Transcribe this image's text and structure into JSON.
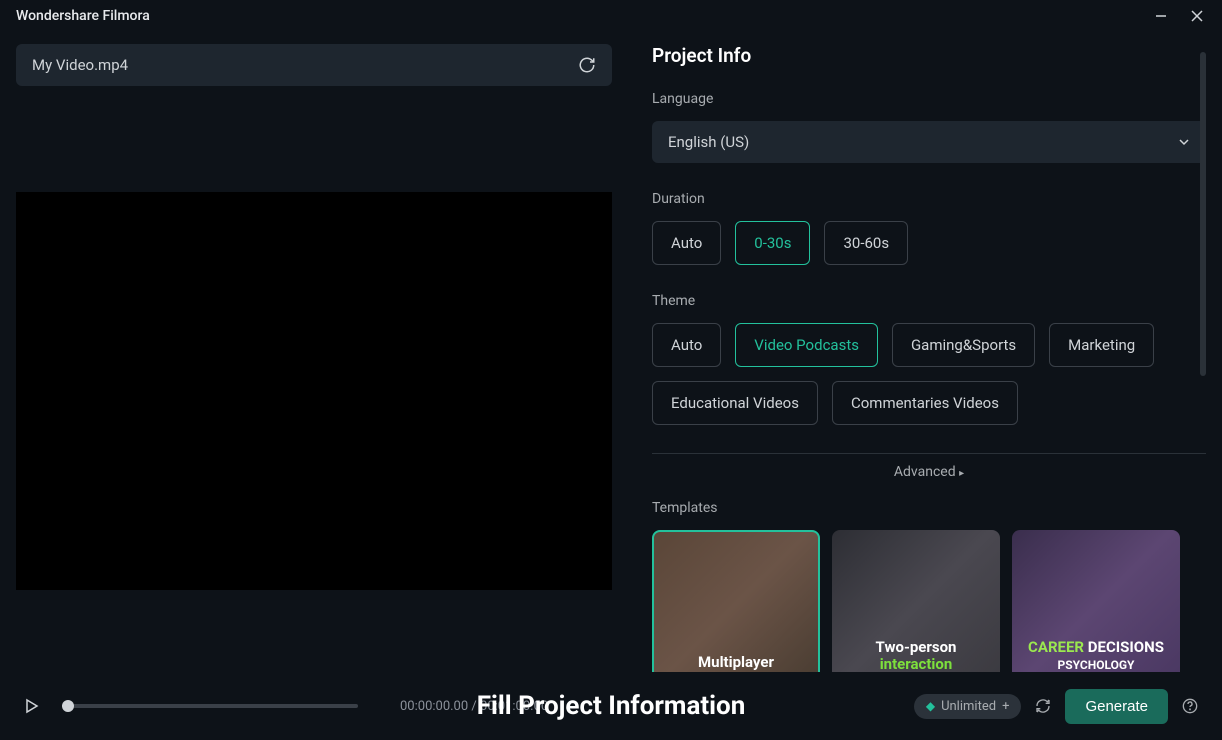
{
  "app_title": "Wondershare Filmora",
  "file": {
    "name": "My Video.mp4"
  },
  "project_info": {
    "title": "Project Info",
    "language": {
      "label": "Language",
      "value": "English (US)"
    },
    "duration": {
      "label": "Duration",
      "options": [
        "Auto",
        "0-30s",
        "30-60s"
      ],
      "selected": 1
    },
    "theme": {
      "label": "Theme",
      "options": [
        "Auto",
        "Video Podcasts",
        "Gaming&Sports",
        "Marketing",
        "Educational Videos",
        "Commentaries Videos"
      ],
      "selected": 1
    },
    "advanced_label": "Advanced",
    "templates": {
      "label": "Templates",
      "items": [
        {
          "top": "Multiplayer",
          "bottom": "",
          "selected": true
        },
        {
          "top": "Two-person",
          "bottom": "interaction",
          "selected": false
        },
        {
          "top": "CAREER",
          "mid": "DECISIONS",
          "bottom": "PSYCHOLOGY",
          "selected": false
        }
      ]
    }
  },
  "playback": {
    "current": "00:00:00.00",
    "sep": "/",
    "total": "00:01:00.00"
  },
  "footer": {
    "caption": "Fill Project Information",
    "unlimited": "Unlimited",
    "generate": "Generate"
  }
}
